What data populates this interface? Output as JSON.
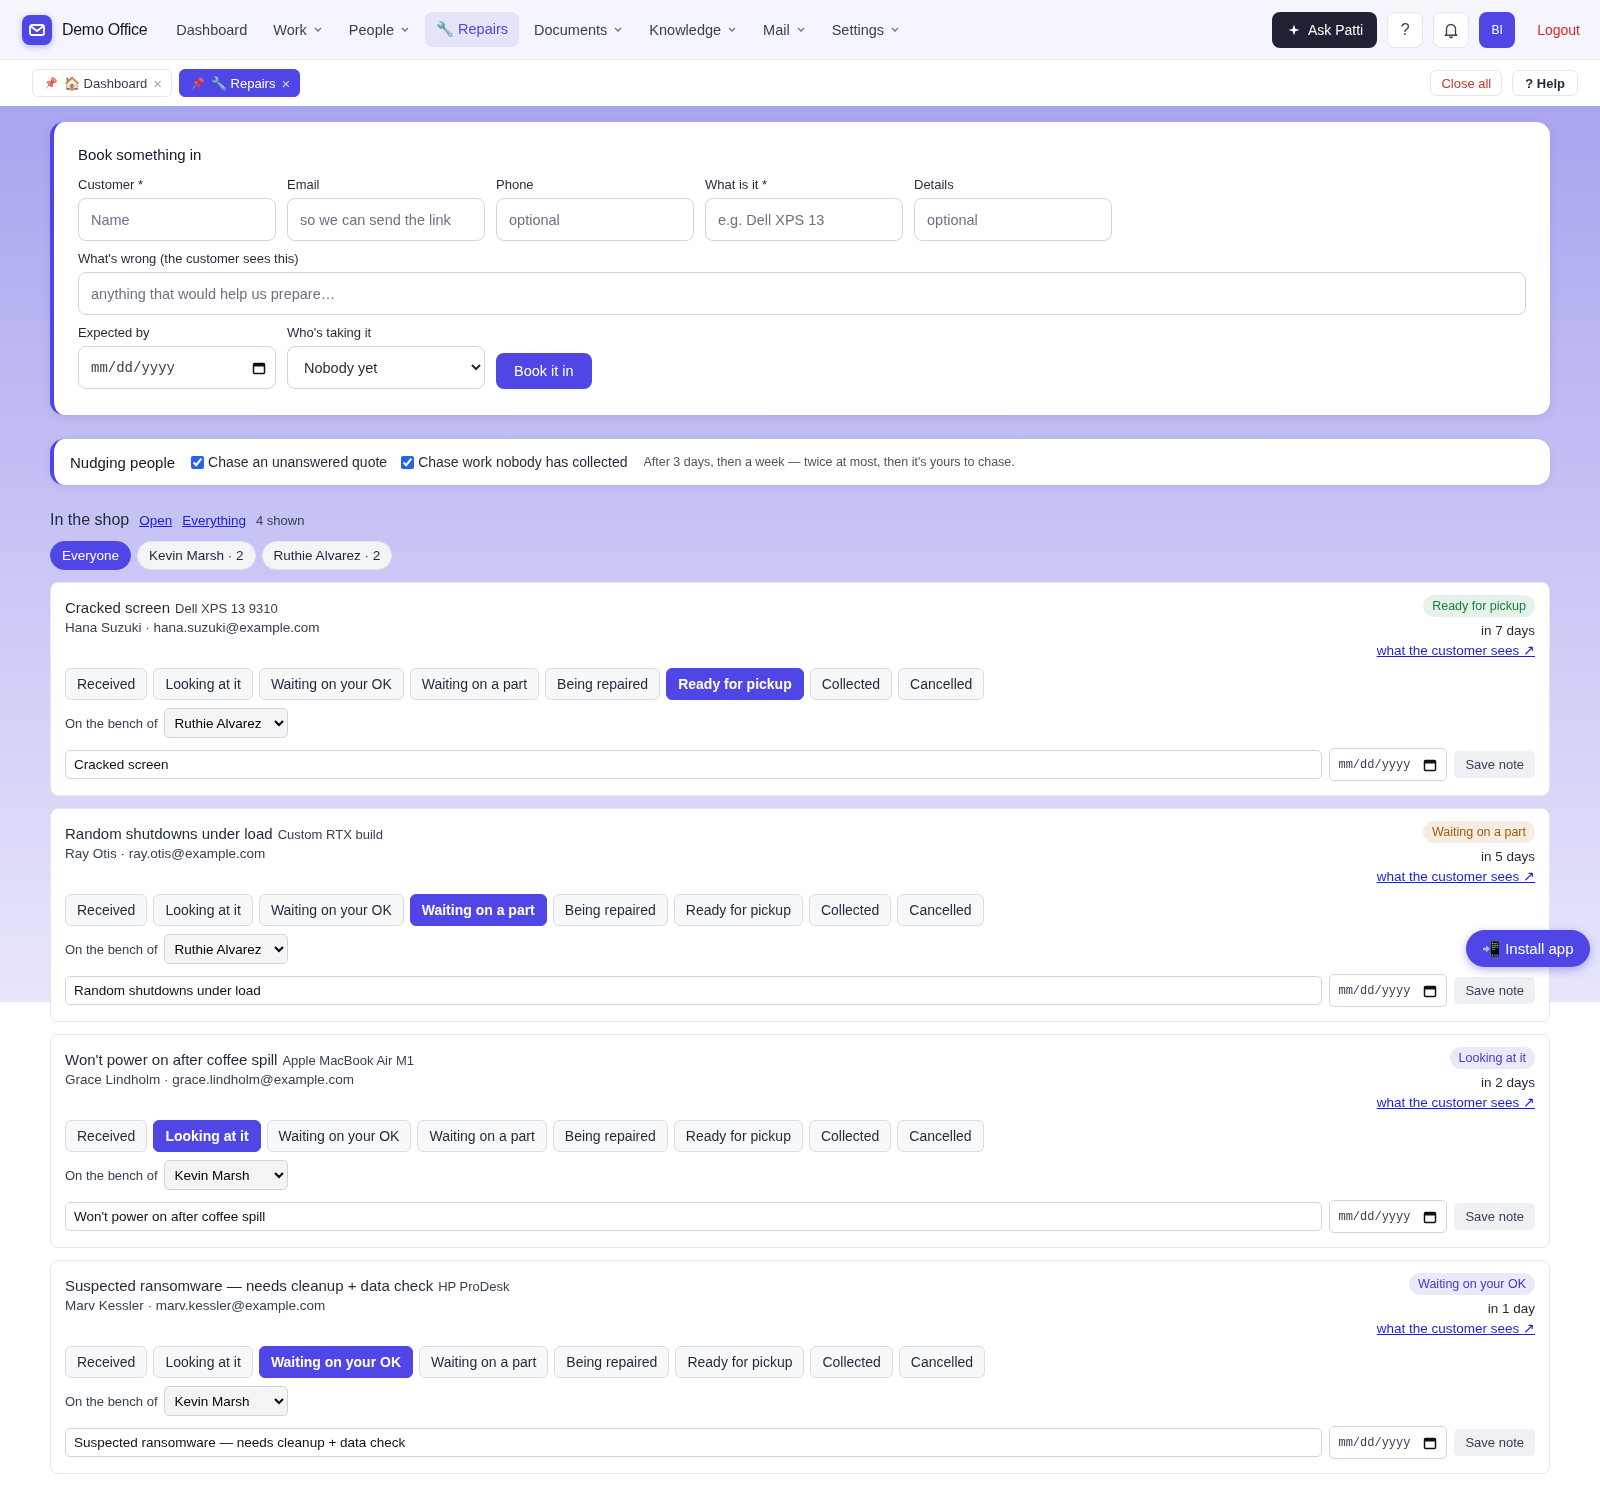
{
  "app": {
    "name": "Demo Office"
  },
  "nav": [
    {
      "label": "Dashboard",
      "dropdown": false,
      "selected": false
    },
    {
      "label": "Work",
      "dropdown": true,
      "selected": false
    },
    {
      "label": "People",
      "dropdown": true,
      "selected": false
    },
    {
      "label": "🔧 Repairs",
      "dropdown": false,
      "selected": true
    },
    {
      "label": "Documents",
      "dropdown": true,
      "selected": false
    },
    {
      "label": "Knowledge",
      "dropdown": true,
      "selected": false
    },
    {
      "label": "Mail",
      "dropdown": true,
      "selected": false
    },
    {
      "label": "Settings",
      "dropdown": true,
      "selected": false
    }
  ],
  "top_actions": {
    "ask": "Ask Patti",
    "help": "?",
    "avatar": "BI",
    "logout": "Logout"
  },
  "open_tabs": [
    {
      "pin": "📌",
      "label": "🏠 Dashboard",
      "close": "×",
      "selected": false
    },
    {
      "pin": "📌",
      "label": "🔧 Repairs",
      "close": "×",
      "selected": true
    }
  ],
  "tab_actions": {
    "close_all": "Close all",
    "help": "? Help"
  },
  "booking": {
    "title": "Book something in",
    "fields": [
      {
        "label": "Customer *",
        "placeholder": "Name"
      },
      {
        "label": "Email",
        "placeholder": "so we can send the link"
      },
      {
        "label": "Phone",
        "placeholder": "optional"
      },
      {
        "label": "What is it *",
        "placeholder": "e.g. Dell XPS 13"
      },
      {
        "label": "Details",
        "placeholder": "optional"
      }
    ],
    "problem": {
      "label": "What's wrong (the customer sees this)",
      "placeholder": "anything that would help us prepare…"
    },
    "expected": {
      "label": "Expected by",
      "placeholder": "mm/dd/yyyy"
    },
    "assignee": {
      "label": "Who's taking it",
      "value": "Nobody yet"
    },
    "submit": "Book it in"
  },
  "nudging": {
    "title": "Nudging people",
    "options": [
      {
        "label": "Chase an unanswered quote",
        "checked": true
      },
      {
        "label": "Chase work nobody has collected",
        "checked": true
      }
    ],
    "note": "After 3 days, then a week — twice at most, then it's yours to chase."
  },
  "shop": {
    "title": "In the shop",
    "links": [
      "Open",
      "Everything"
    ],
    "count": "4 shown",
    "filters": [
      {
        "label": "Everyone",
        "selected": true
      },
      {
        "label": "Kevin Marsh · 2",
        "selected": false
      },
      {
        "label": "Ruthie Alvarez · 2",
        "selected": false
      }
    ]
  },
  "tickets": [
    {
      "title": "Cracked screen",
      "device": "Dell XPS 13 9310",
      "customer": "Hana Suzuki · hana.suzuki@example.com",
      "badge": {
        "label": "Ready for pickup",
        "color": "#15803d"
      },
      "due": "in 7 days",
      "link": "what the customer sees ↗",
      "statuses": [
        {
          "label": "Received",
          "selected": false
        },
        {
          "label": "Looking at it",
          "selected": false
        },
        {
          "label": "Waiting on your OK",
          "selected": false
        },
        {
          "label": "Waiting on a part",
          "selected": false
        },
        {
          "label": "Being repaired",
          "selected": false
        },
        {
          "label": "Ready for pickup",
          "selected": true
        },
        {
          "label": "Collected",
          "selected": false
        },
        {
          "label": "Cancelled",
          "selected": false
        }
      ],
      "bench_label": "On the bench of",
      "bench": "Ruthie Alvarez",
      "note": "Cracked screen",
      "date_placeholder": "mm/dd/yyyy",
      "save": "Save note"
    },
    {
      "title": "Random shutdowns under load",
      "device": "Custom RTX build",
      "customer": "Ray Otis · ray.otis@example.com",
      "badge": {
        "label": "Waiting on a part",
        "color": "#a15c07"
      },
      "due": "in 5 days",
      "link": "what the customer sees ↗",
      "statuses": [
        {
          "label": "Received",
          "selected": false
        },
        {
          "label": "Looking at it",
          "selected": false
        },
        {
          "label": "Waiting on your OK",
          "selected": false
        },
        {
          "label": "Waiting on a part",
          "selected": true
        },
        {
          "label": "Being repaired",
          "selected": false
        },
        {
          "label": "Ready for pickup",
          "selected": false
        },
        {
          "label": "Collected",
          "selected": false
        },
        {
          "label": "Cancelled",
          "selected": false
        }
      ],
      "bench_label": "On the bench of",
      "bench": "Ruthie Alvarez",
      "note": "Random shutdowns under load",
      "date_placeholder": "mm/dd/yyyy",
      "save": "Save note"
    },
    {
      "title": "Won't power on after coffee spill",
      "device": "Apple MacBook Air M1",
      "customer": "Grace Lindholm · grace.lindholm@example.com",
      "badge": {
        "label": "Looking at it",
        "color": "#4338ca"
      },
      "due": "in 2 days",
      "link": "what the customer sees ↗",
      "statuses": [
        {
          "label": "Received",
          "selected": false
        },
        {
          "label": "Looking at it",
          "selected": true
        },
        {
          "label": "Waiting on your OK",
          "selected": false
        },
        {
          "label": "Waiting on a part",
          "selected": false
        },
        {
          "label": "Being repaired",
          "selected": false
        },
        {
          "label": "Ready for pickup",
          "selected": false
        },
        {
          "label": "Collected",
          "selected": false
        },
        {
          "label": "Cancelled",
          "selected": false
        }
      ],
      "bench_label": "On the bench of",
      "bench": "Kevin Marsh",
      "note": "Won't power on after coffee spill",
      "date_placeholder": "mm/dd/yyyy",
      "save": "Save note"
    },
    {
      "title": "Suspected ransomware — needs cleanup + data check",
      "device": "HP ProDesk",
      "customer": "Marv Kessler · marv.kessler@example.com",
      "badge": {
        "label": "Waiting on your OK",
        "color": "#4338ca"
      },
      "due": "in 1 day",
      "link": "what the customer sees ↗",
      "statuses": [
        {
          "label": "Received",
          "selected": false
        },
        {
          "label": "Looking at it",
          "selected": false
        },
        {
          "label": "Waiting on your OK",
          "selected": true
        },
        {
          "label": "Waiting on a part",
          "selected": false
        },
        {
          "label": "Being repaired",
          "selected": false
        },
        {
          "label": "Ready for pickup",
          "selected": false
        },
        {
          "label": "Collected",
          "selected": false
        },
        {
          "label": "Cancelled",
          "selected": false
        }
      ],
      "bench_label": "On the bench of",
      "bench": "Kevin Marsh",
      "note": "Suspected ransomware — needs cleanup + data check",
      "date_placeholder": "mm/dd/yyyy",
      "save": "Save note"
    }
  ],
  "install": {
    "label": "📲 Install app"
  }
}
